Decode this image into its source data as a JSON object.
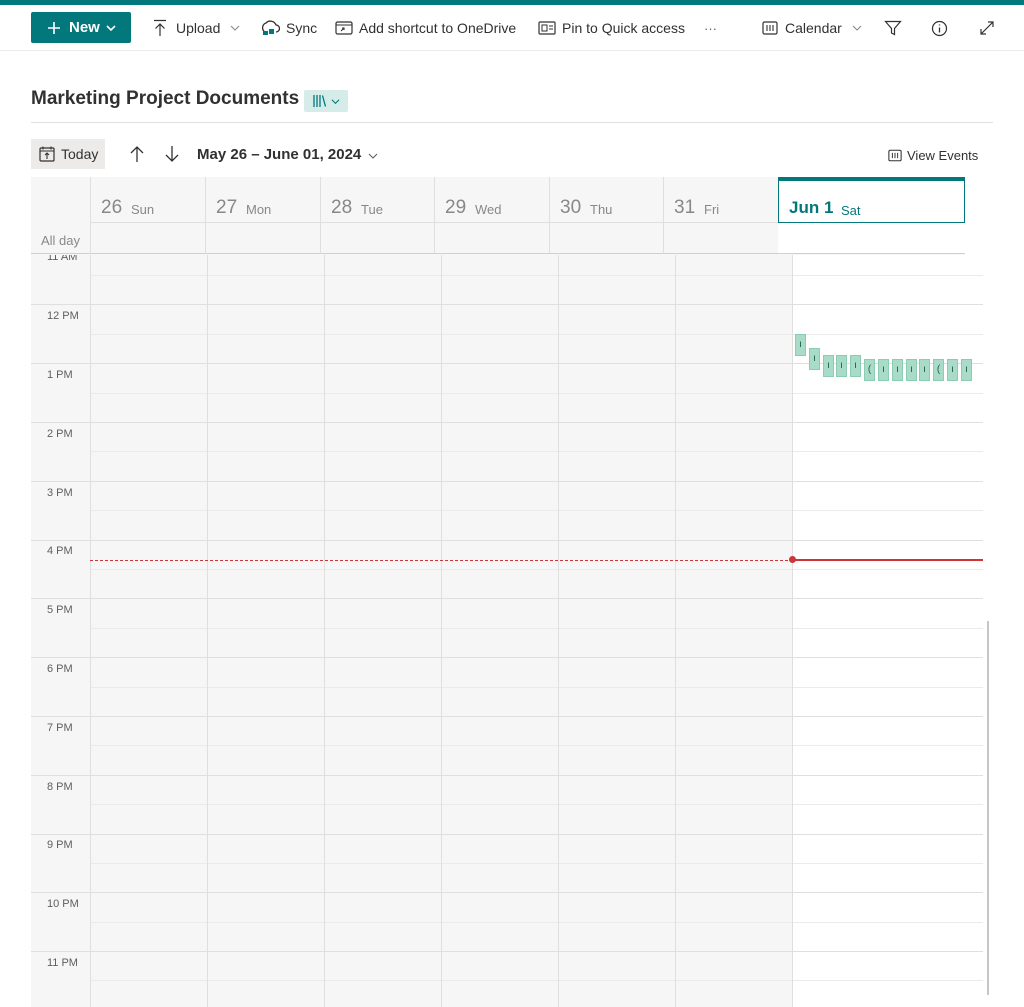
{
  "colors": {
    "accent": "#03787c",
    "now_line": "#d13438",
    "event_fill": "#a8dcc8",
    "past_bg": "#f6f6f6"
  },
  "toolbar": {
    "new_label": "New",
    "upload_label": "Upload",
    "sync_label": "Sync",
    "add_shortcut_label": "Add shortcut to OneDrive",
    "pin_label": "Pin to Quick access",
    "more_label": "···",
    "view_label": "Calendar"
  },
  "page": {
    "title": "Marketing Project Documents"
  },
  "calendar": {
    "today_label": "Today",
    "range_label": "May 26 – June 01, 2024",
    "view_events_label": "View Events",
    "allday_label": "All day",
    "days": [
      {
        "num": "26",
        "name": "Sun"
      },
      {
        "num": "27",
        "name": "Mon"
      },
      {
        "num": "28",
        "name": "Tue"
      },
      {
        "num": "29",
        "name": "Wed"
      },
      {
        "num": "30",
        "name": "Thu"
      },
      {
        "num": "31",
        "name": "Fri"
      }
    ],
    "today": {
      "num": "Jun 1",
      "name": "Sat"
    },
    "hours": [
      "11 AM",
      "12 PM",
      "1 PM",
      "2 PM",
      "3 PM",
      "4 PM",
      "5 PM",
      "6 PM",
      "7 PM",
      "8 PM",
      "9 PM",
      "10 PM",
      "11 PM"
    ],
    "event_chips": [
      "ı",
      "ı",
      "ı",
      "ı",
      "ı",
      "(",
      "ı",
      "ı",
      "ı",
      "ı",
      "(",
      "ı",
      "ı"
    ]
  }
}
